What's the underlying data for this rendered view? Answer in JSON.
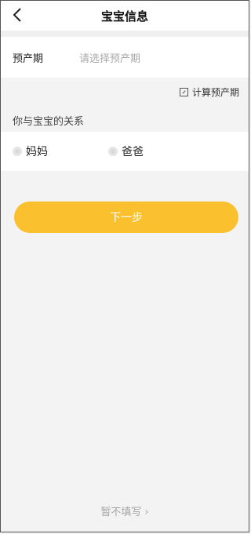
{
  "header": {
    "title": "宝宝信息",
    "back_icon": "chevron-left-icon"
  },
  "form": {
    "due_date_label": "预产期",
    "due_date_placeholder": "请选择预产期",
    "calculate_link": "计算预产期",
    "calculate_icon": "edit-box-icon",
    "relation_label": "你与宝宝的关系",
    "relation_options": [
      "妈妈",
      "爸爸"
    ]
  },
  "actions": {
    "next_label": "下一步",
    "skip_label": "暂不填写"
  },
  "colors": {
    "accent": "#fbc02d",
    "background": "#f3f3f3",
    "placeholder": "#a9a9a9"
  }
}
